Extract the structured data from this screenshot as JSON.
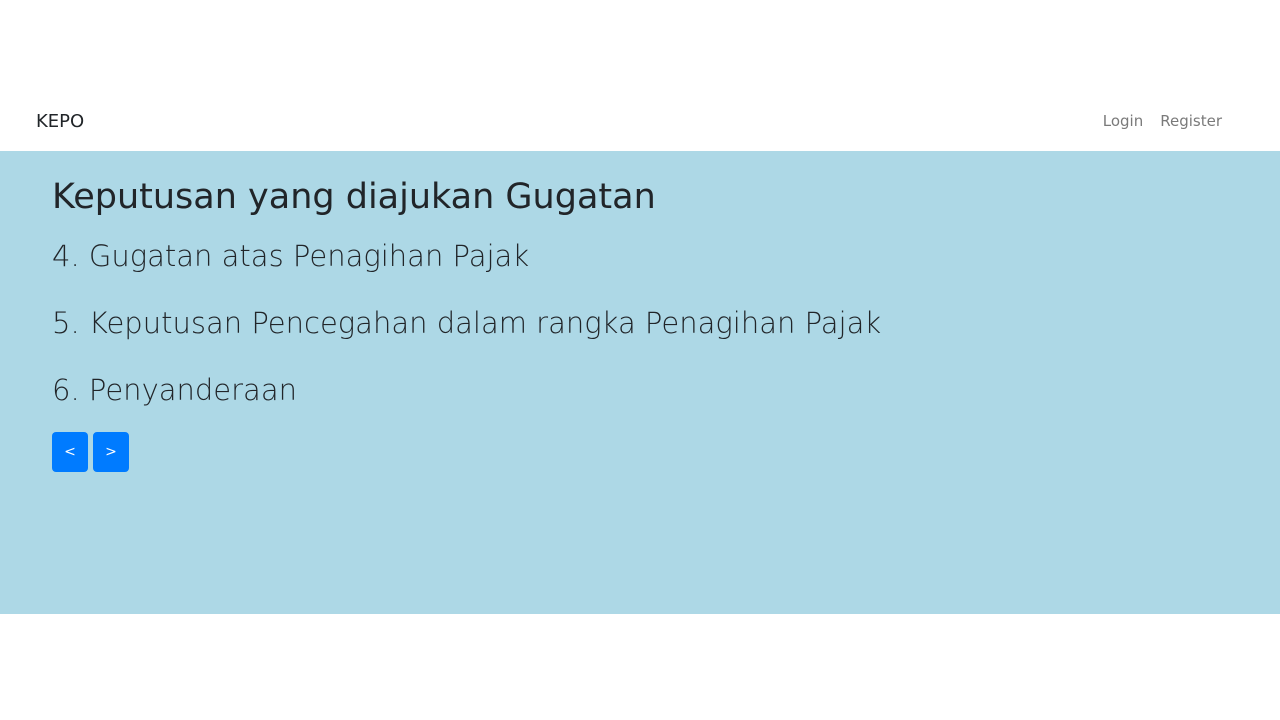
{
  "navbar": {
    "brand": "KEPO",
    "links": [
      {
        "label": "Login"
      },
      {
        "label": "Register"
      }
    ]
  },
  "hero": {
    "title": "Keputusan yang diajukan Gugatan",
    "items": [
      "4. Gugatan atas Penagihan Pajak",
      "5. Keputusan Pencegahan dalam rangka Penagihan Pajak",
      "6. Penyanderaan"
    ],
    "pager": {
      "prev_label": "<",
      "next_label": ">"
    }
  },
  "colors": {
    "hero_background": "#add8e6",
    "button_background": "#007bff",
    "text": "#212529",
    "nav_link": "#7a7a7a"
  }
}
